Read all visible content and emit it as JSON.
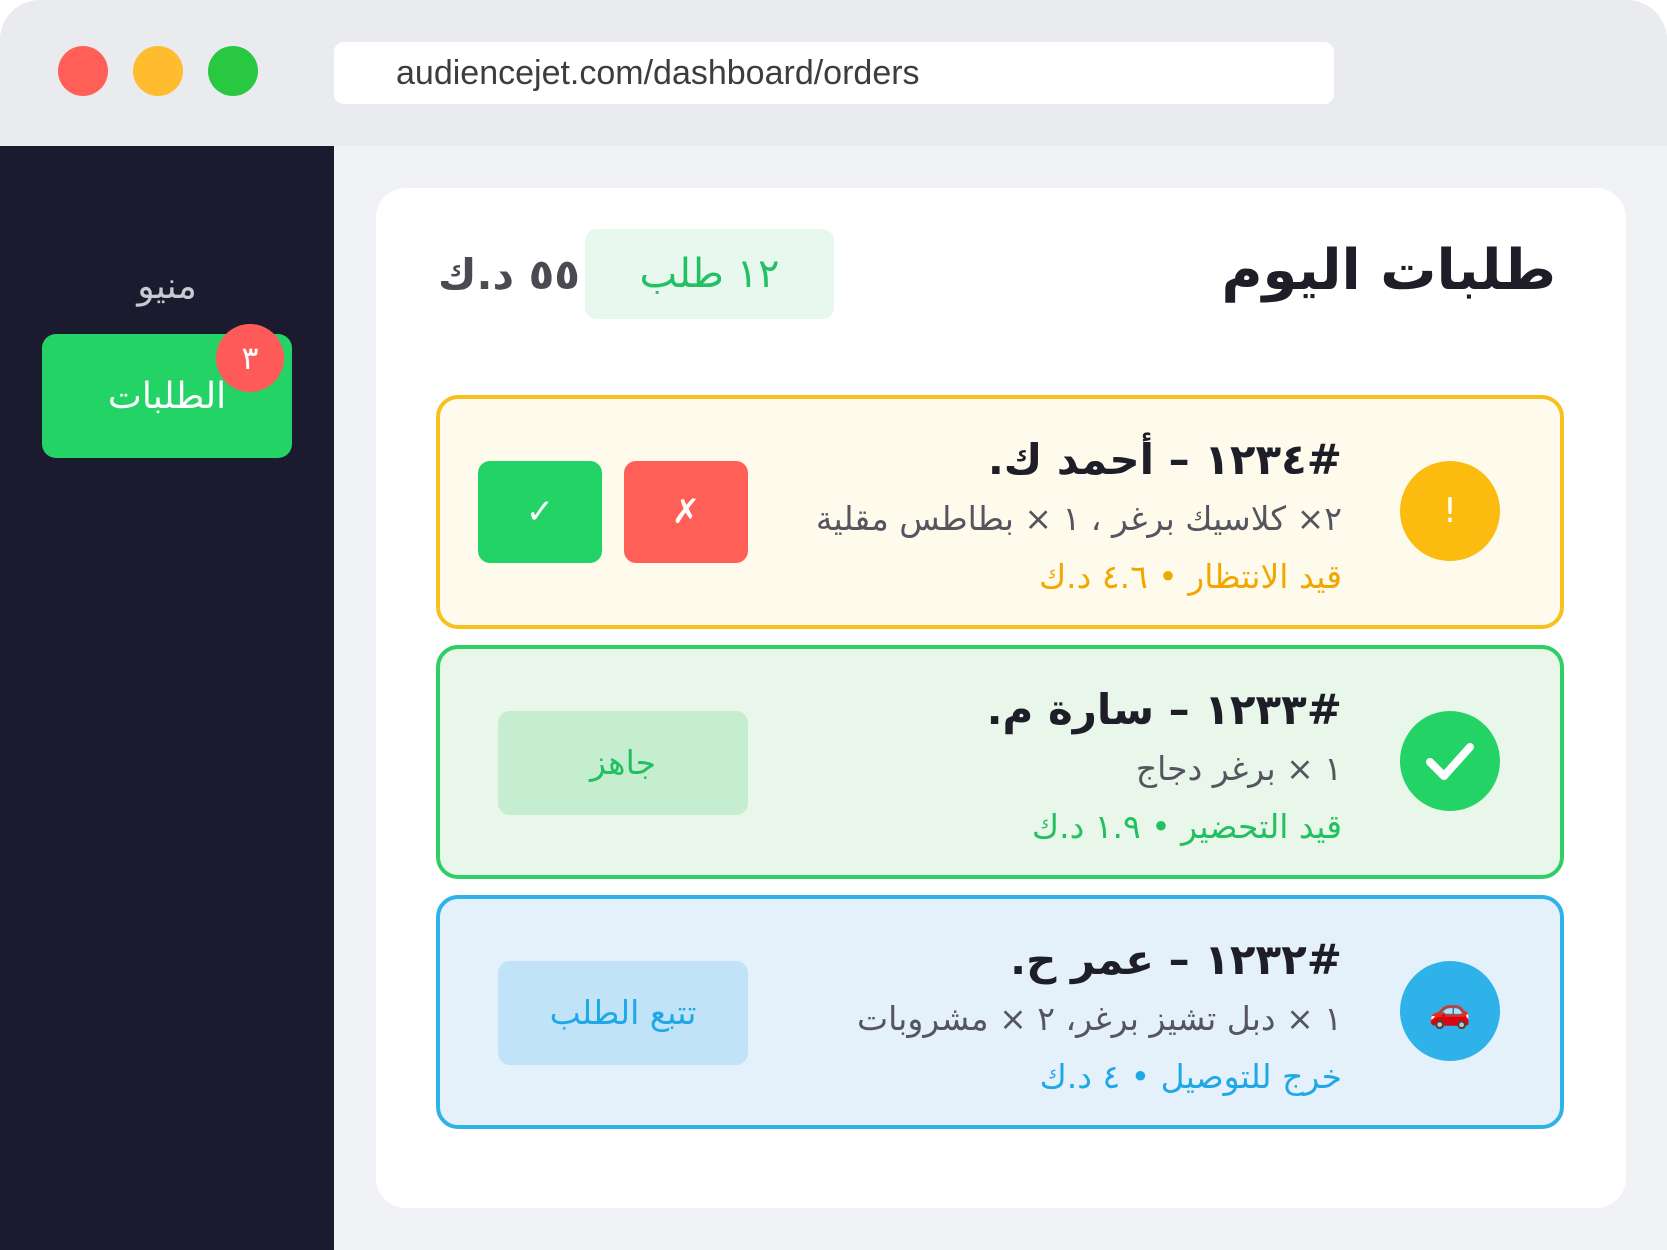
{
  "browser": {
    "url": "audiencejet.com/dashboard/orders"
  },
  "sidebar": {
    "title": "منيو",
    "items": [
      {
        "label": "الطلبات",
        "badge": "٣"
      }
    ]
  },
  "header": {
    "title": "طلبات اليوم",
    "order_count": "١٢ طلب",
    "total": "٥٥ د.ك"
  },
  "orders": [
    {
      "title": "#١٢٣٤ – أحمد ك.",
      "items": "٢× كلاسيك برغر ، ١ × بطاطس مقلية",
      "status": "قيد الانتظار • ٤.٦ د.ك",
      "icon": "!",
      "icon_name": "alert-icon",
      "reject_label": "✗",
      "accept_label": "✓"
    },
    {
      "title": "#١٢٣٣ – سارة م.",
      "items": "١ × برغر دجاج",
      "status": "قيد التحضير • ١.٩ د.ك",
      "icon_name": "checkmark-icon",
      "action_label": "جاهز"
    },
    {
      "title": "#١٢٣٢ – عمر ح.",
      "items": "١ × دبل تشيز برغر، ٢ × مشروبات",
      "status": "خرج للتوصيل • ٤ د.ك",
      "icon": "🚗",
      "icon_name": "car-icon",
      "action_label": "تتبع الطلب"
    }
  ],
  "colors": {
    "pending": "#f8c01c",
    "preparing": "#2fce66",
    "delivery": "#2fb2ea",
    "accent_green": "#24d366",
    "reject_red": "#ff5f57",
    "sidebar_bg": "#1a1b2e"
  }
}
